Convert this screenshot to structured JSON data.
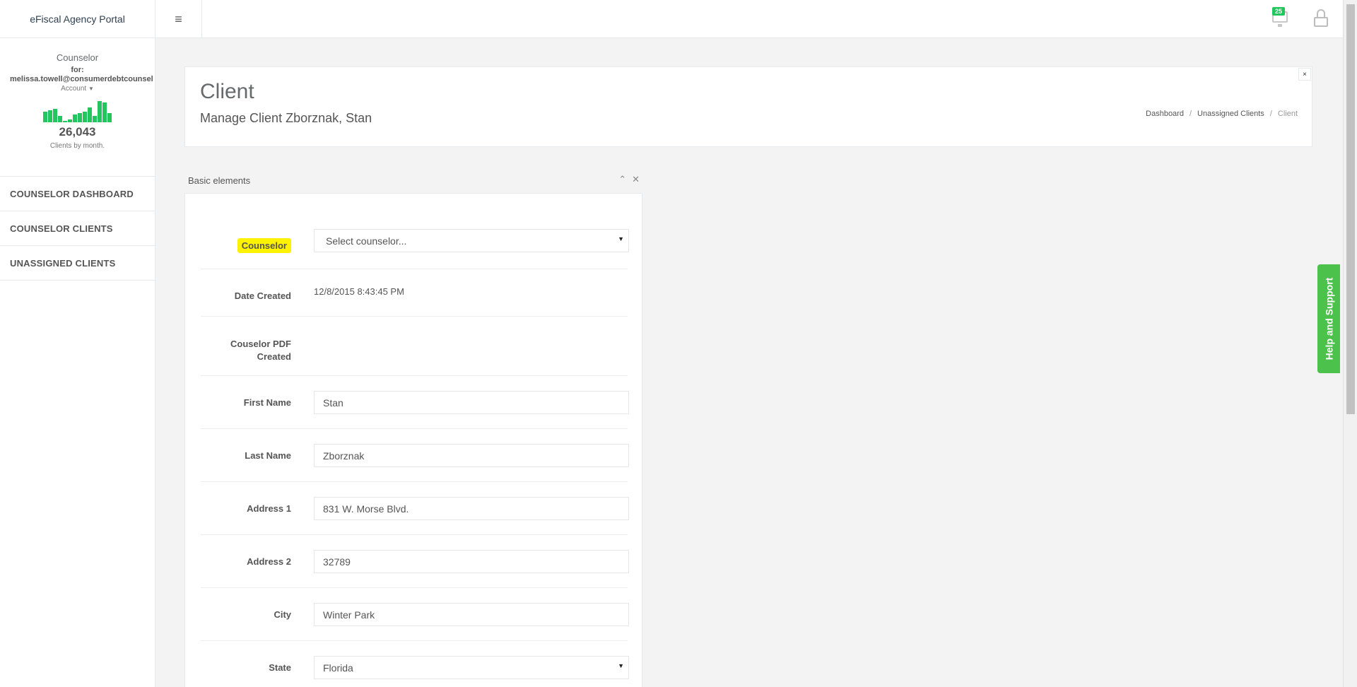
{
  "app": {
    "title": "eFiscal Agency Portal"
  },
  "topbar": {
    "notification_count": "25"
  },
  "sidebar": {
    "role": "Counselor",
    "for_label": "for:",
    "email": "melissa.towell@consumerdebtcounsel",
    "account_label": "Account",
    "sparkline_values": [
      7,
      8,
      9,
      4,
      1,
      2,
      5,
      6,
      7,
      10,
      4,
      14,
      13,
      6
    ],
    "total": "26,043",
    "caption": "Clients by month.",
    "items": [
      {
        "label": "COUNSELOR DASHBOARD"
      },
      {
        "label": "COUNSELOR CLIENTS"
      },
      {
        "label": "UNASSIGNED CLIENTS"
      }
    ]
  },
  "header": {
    "title": "Client",
    "subtitle": "Manage Client Zborznak, Stan",
    "close": "×",
    "breadcrumb": [
      "Dashboard",
      "Unassigned Clients",
      "Client"
    ]
  },
  "panel": {
    "title": "Basic elements",
    "collapse_icon": "chevron-up-icon",
    "close_icon": "close-icon"
  },
  "form": {
    "counselor": {
      "label": "Counselor",
      "placeholder": "Select counselor..."
    },
    "date_created": {
      "label": "Date Created",
      "value": "12/8/2015 8:43:45 PM"
    },
    "pdf_created": {
      "label_line1": "Couselor PDF",
      "label_line2": "Created",
      "value": ""
    },
    "first_name": {
      "label": "First Name",
      "value": "Stan"
    },
    "last_name": {
      "label": "Last Name",
      "value": "Zborznak"
    },
    "address1": {
      "label": "Address 1",
      "value": "831 W. Morse Blvd."
    },
    "address2": {
      "label": "Address 2",
      "value": "32789"
    },
    "city": {
      "label": "City",
      "value": "Winter Park"
    },
    "state": {
      "label": "State",
      "value": "Florida"
    }
  },
  "help": {
    "label": "Help and Support"
  },
  "colors": {
    "accent": "#22c55e",
    "highlight": "#fff200",
    "help_tab": "#4cc14c"
  }
}
